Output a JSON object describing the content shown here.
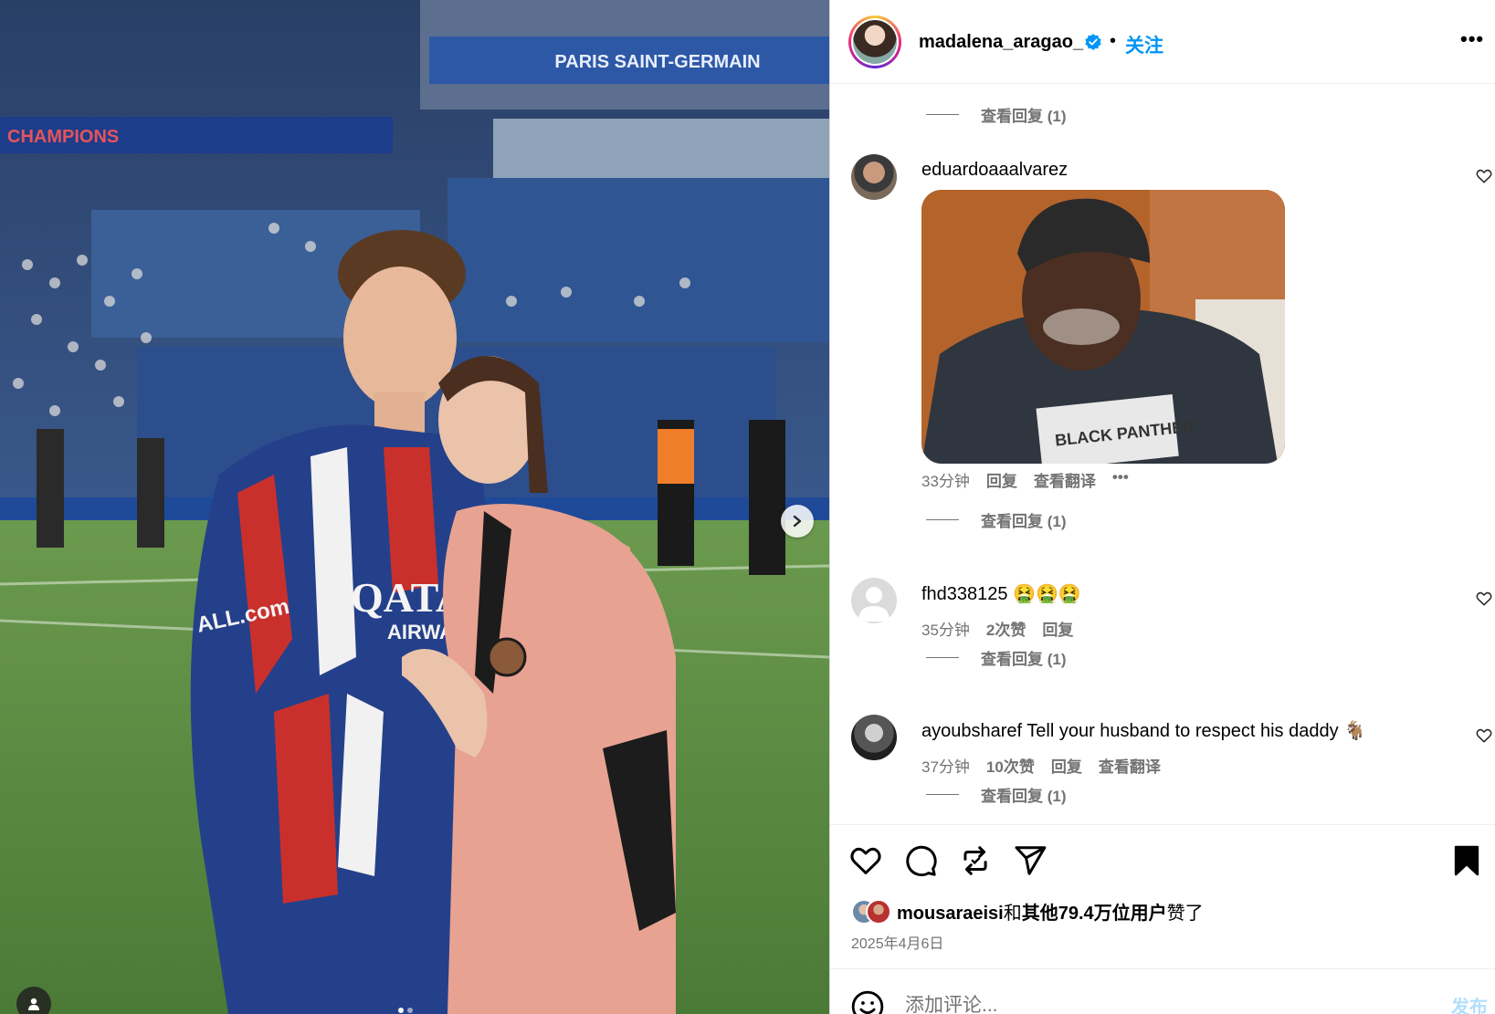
{
  "photo": {
    "stadium_banner": "PARIS SAINT-GERMAIN",
    "side_banner": "CHAMPIONS",
    "shirt_sponsor": "QATAR",
    "shirt_sponsor_sub": "AIRWAYS",
    "sleeve_text": "ALL.com",
    "next_icon": "chevron-right-icon",
    "tag_icon": "person-icon"
  },
  "header": {
    "username": "madalena_aragao_",
    "verified_icon": "verified-badge-icon",
    "separator": "•",
    "follow_label": "关注",
    "more_label": "•••"
  },
  "comments": [
    {
      "view_replies": "查看回复 (1)"
    },
    {
      "username": "eduardoaaalvarez",
      "gif_text": "BLACK PANTHER",
      "time": "33分钟",
      "reply": "回复",
      "translate": "查看翻译",
      "more": "•••",
      "view_replies": "查看回复 (1)"
    },
    {
      "username": "fhd338125",
      "text": "🤮🤮🤮",
      "time": "35分钟",
      "likes": "2次赞",
      "reply": "回复",
      "view_replies": "查看回复 (1)"
    },
    {
      "username": "ayoubsharef",
      "text": "Tell your husband to respect his daddy 🐐",
      "time": "37分钟",
      "likes": "10次赞",
      "reply": "回复",
      "translate": "查看翻译",
      "view_replies": "查看回复 (1)"
    }
  ],
  "actions": {
    "like_icon": "heart-icon",
    "comment_icon": "comment-bubble-icon",
    "repost_icon": "repost-icon",
    "share_icon": "send-icon",
    "save_icon": "bookmark-filled-icon"
  },
  "likes": {
    "liker": "mousaraeisi",
    "and": "和",
    "others": "其他79.4万位用户",
    "suffix": "赞了"
  },
  "date": "2025年4月6日",
  "comment_box": {
    "placeholder": "添加评论...",
    "post_label": "发布"
  },
  "colors": {
    "link_blue": "#0095f6",
    "meta_gray": "#737373",
    "post_disabled": "#b2dffc"
  }
}
